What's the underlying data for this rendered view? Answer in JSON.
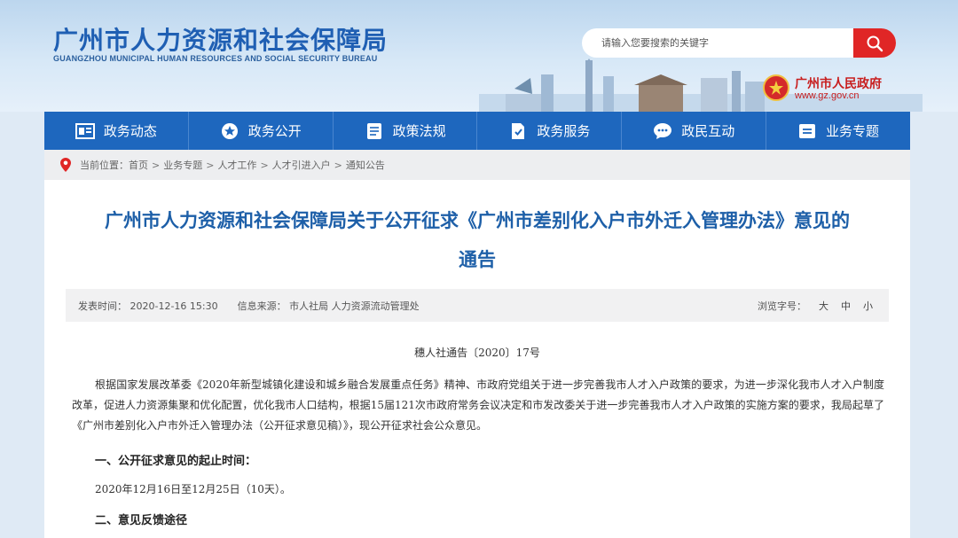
{
  "header": {
    "site_title": "广州市人力资源和社会保障局",
    "site_subtitle": "GUANGZHOU MUNICIPAL HUMAN RESOURCES AND SOCIAL SECURITY BUREAU",
    "search_placeholder": "请输入您要搜索的关键字",
    "gov_name": "广州市人民政府",
    "gov_url": "www.gz.gov.cn"
  },
  "nav": {
    "items": [
      {
        "label": "政务动态",
        "icon": "news-icon"
      },
      {
        "label": "政务公开",
        "icon": "star-icon"
      },
      {
        "label": "政策法规",
        "icon": "document-icon"
      },
      {
        "label": "政务服务",
        "icon": "service-icon"
      },
      {
        "label": "政民互动",
        "icon": "chat-icon"
      },
      {
        "label": "业务专题",
        "icon": "topic-icon"
      }
    ]
  },
  "breadcrumb": {
    "prefix": "当前位置：",
    "items": [
      "首页",
      "业务专题",
      "人才工作",
      "人才引进入户",
      "通知公告"
    ],
    "separator": ">"
  },
  "article": {
    "title_line1": "广州市人力资源和社会保障局关于公开征求《广州市差别化入户市外迁入管理办法》意见的",
    "title_line2": "通告",
    "publish_time": "发表时间：  2020-12-16 15:30",
    "source": "信息来源：  市人社局 人力资源流动管理处",
    "font_size_label": "浏览字号：",
    "size_large": "大",
    "size_medium": "中",
    "size_small": "小",
    "doc_number": "穗人社通告〔2020〕17号",
    "paragraph": "根据国家发展改革委《2020年新型城镇化建设和城乡融合发展重点任务》精神、市政府党组关于进一步完善我市人才入户政策的要求，为进一步深化我市人才入户制度改革，促进人力资源集聚和优化配置，优化我市人口结构，根据15届121次市政府常务会议决定和市发改委关于进一步完善我市人才入户政策的实施方案的要求，我局起草了《广州市差别化入户市外迁入管理办法（公开征求意见稿）》，现公开征求社会公众意见。",
    "section1_heading": "一、公开征求意见的起止时间：",
    "section1_text": "2020年12月16日至12月25日（10天）。",
    "section2_heading": "二、意见反馈途径"
  },
  "colors": {
    "nav_bg": "#1e67be",
    "title_blue": "#1d5fa8",
    "search_btn_red": "#e02626"
  }
}
